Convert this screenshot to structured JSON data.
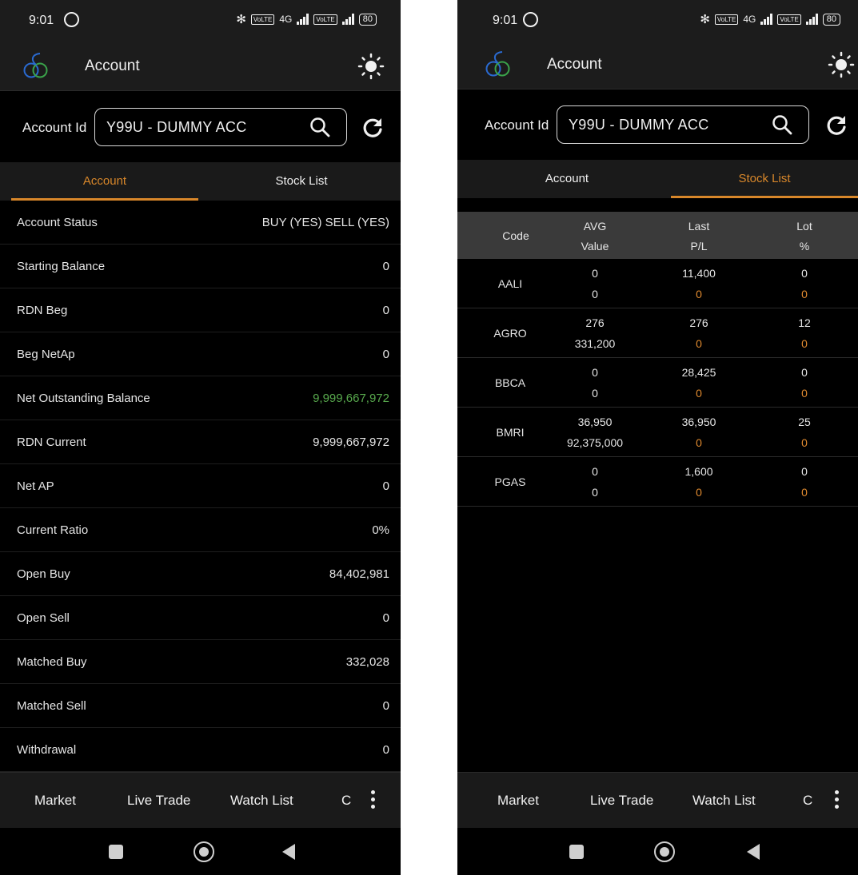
{
  "status_bar": {
    "time": "9:01",
    "lte": "VoLTE",
    "net": "4G",
    "battery": "80"
  },
  "app_bar": {
    "title": "Account"
  },
  "account_selector": {
    "label": "Account Id",
    "value": "Y99U - DUMMY ACC"
  },
  "tabs": [
    {
      "label": "Account"
    },
    {
      "label": "Stock List"
    }
  ],
  "account_rows": [
    {
      "label": "Account Status",
      "value": "BUY (YES) SELL (YES)"
    },
    {
      "label": "Starting Balance",
      "value": "0"
    },
    {
      "label": "RDN Beg",
      "value": "0"
    },
    {
      "label": "Beg NetAp",
      "value": "0"
    },
    {
      "label": "Net Outstanding Balance",
      "value": "9,999,667,972"
    },
    {
      "label": "RDN Current",
      "value": "9,999,667,972"
    },
    {
      "label": "Net AP",
      "value": "0"
    },
    {
      "label": "Current Ratio",
      "value": "0%"
    },
    {
      "label": "Open Buy",
      "value": "84,402,981"
    },
    {
      "label": "Open Sell",
      "value": "0"
    },
    {
      "label": "Matched Buy",
      "value": "332,028"
    },
    {
      "label": "Matched Sell",
      "value": "0"
    },
    {
      "label": "Withdrawal",
      "value": "0"
    }
  ],
  "stock_table": {
    "headers": {
      "code": "Code",
      "avg": "AVG",
      "value": "Value",
      "last": "Last",
      "pl": "P/L",
      "lot": "Lot",
      "pct": "%"
    },
    "rows": [
      {
        "code": "AALI",
        "avg": "0",
        "value": "0",
        "last": "11,400",
        "pl": "0",
        "lot": "0",
        "pct": "0"
      },
      {
        "code": "AGRO",
        "avg": "276",
        "value": "331,200",
        "last": "276",
        "pl": "0",
        "lot": "12",
        "pct": "0"
      },
      {
        "code": "BBCA",
        "avg": "0",
        "value": "0",
        "last": "28,425",
        "pl": "0",
        "lot": "0",
        "pct": "0"
      },
      {
        "code": "BMRI",
        "avg": "36,950",
        "value": "92,375,000",
        "last": "36,950",
        "pl": "0",
        "lot": "25",
        "pct": "0"
      },
      {
        "code": "PGAS",
        "avg": "0",
        "value": "0",
        "last": "1,600",
        "pl": "0",
        "lot": "0",
        "pct": "0"
      }
    ]
  },
  "bottom_nav": {
    "items": [
      "Market",
      "Live Trade",
      "Watch List",
      "C"
    ]
  },
  "colors": {
    "accent": "#d8872a",
    "positive": "#58a94d",
    "pl_orange": "#e08a2f",
    "background": "#000000",
    "bar": "#1c1c1c"
  }
}
